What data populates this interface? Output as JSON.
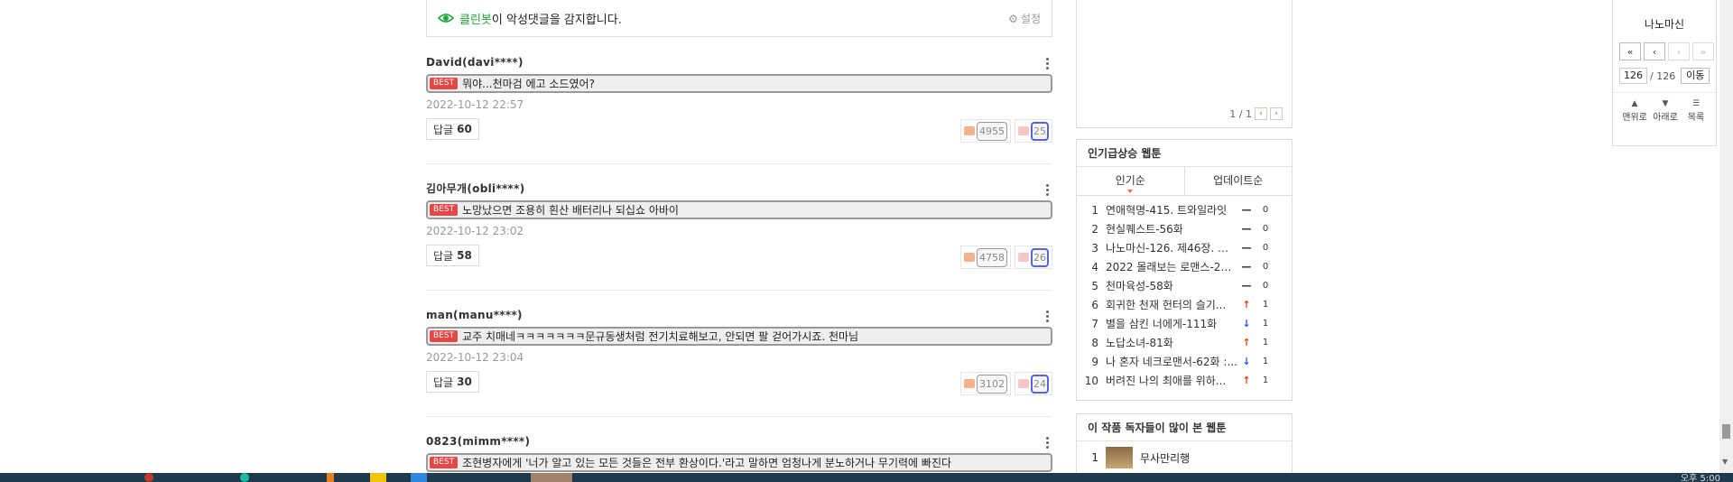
{
  "cleanbot": {
    "brand": "클린봇",
    "message": "이 악성댓글을 감지합니다.",
    "settings_label": "설정"
  },
  "comments": [
    {
      "author": "David(davi****)",
      "best": "BEST",
      "text": "뭐야...천마검 에고 소드였어?",
      "date": "2022-10-12 22:57",
      "reply_label": "답글",
      "reply_count": "60",
      "likes": "4955",
      "dislikes": "25"
    },
    {
      "author": "김아무개(obli****)",
      "best": "BEST",
      "text": "노망났으면 조용히 흰산 배터리나 되십쇼 아바이",
      "date": "2022-10-12 23:02",
      "reply_label": "답글",
      "reply_count": "58",
      "likes": "4758",
      "dislikes": "26"
    },
    {
      "author": "man(manu****)",
      "best": "BEST",
      "text": "교주 치매네ㅋㅋㅋㅋㅋㅋㅋ문규동생처럼 전기치료해보고, 안되면 팔 걷어가시죠. 천마님",
      "date": "2022-10-12 23:04",
      "reply_label": "답글",
      "reply_count": "30",
      "likes": "3102",
      "dislikes": "24"
    },
    {
      "author": "0823(mimm****)",
      "best": "BEST",
      "text": "조현병자에게 '너가 알고 있는 모든 것들은 전부 환상이다.'라고 말하면 엄청나게 분노하거나 무기력에 빠진다"
    }
  ],
  "top_panel": {
    "page": "1 / 1"
  },
  "rising": {
    "title": "인기급상승 웹툰",
    "tabs": [
      "인기순",
      "업데이트순"
    ],
    "items": [
      {
        "rank": "1",
        "title": "연애혁명-415. 트와일라잇",
        "trend": "same",
        "change": "0"
      },
      {
        "rank": "2",
        "title": "현실퀘스트-56화",
        "trend": "same",
        "change": "0"
      },
      {
        "rank": "3",
        "title": "나노마신-126. 제46장. 진...",
        "trend": "same",
        "change": "0"
      },
      {
        "rank": "4",
        "title": "2022 몰래보는 로맨스-21...",
        "trend": "same",
        "change": "0"
      },
      {
        "rank": "5",
        "title": "천마육성-58화",
        "trend": "same",
        "change": "0"
      },
      {
        "rank": "6",
        "title": "회귀한 천재 헌터의 슬기...",
        "trend": "up",
        "change": "1"
      },
      {
        "rank": "7",
        "title": "별을 삼킨 너에게-111화",
        "trend": "down",
        "change": "1"
      },
      {
        "rank": "8",
        "title": "노답소녀-81화",
        "trend": "up",
        "change": "1"
      },
      {
        "rank": "9",
        "title": "나 혼자 네크로맨서-62화 :...",
        "trend": "down",
        "change": "1"
      },
      {
        "rank": "10",
        "title": "버려진 나의 최애를 위하...",
        "trend": "up",
        "change": "1"
      }
    ]
  },
  "readers": {
    "title": "이 작품 독자들이 많이 본 웹툰",
    "items": [
      {
        "rank": "1",
        "title": "무사만리행"
      }
    ]
  },
  "nav": {
    "title": "나노마신",
    "first": "«",
    "prev": "‹",
    "next": "›",
    "last": "»",
    "current_page": "126",
    "total_pages": "/ 126",
    "go_label": "이동",
    "top_label": "맨위로",
    "bottom_label": "아래로",
    "list_label": "목록"
  },
  "taskbar": {
    "clock": "오후 5:00"
  },
  "colors": {
    "brand_green": "#1ea83c",
    "best_red": "#e84545",
    "trend_up": "#f04010",
    "trend_down": "#2255ee"
  }
}
